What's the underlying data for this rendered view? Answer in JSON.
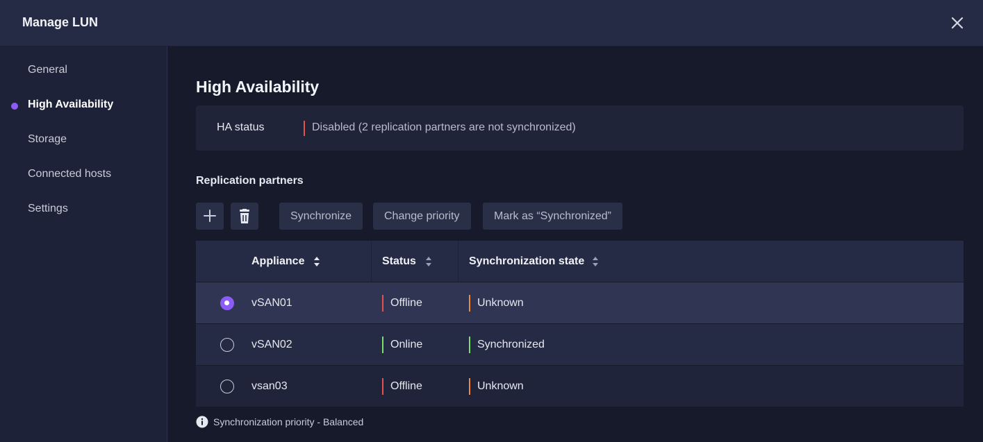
{
  "window": {
    "title": "Manage LUN"
  },
  "sidebar": {
    "items": [
      {
        "label": "General",
        "active": false
      },
      {
        "label": "High Availability",
        "active": true
      },
      {
        "label": "Storage",
        "active": false
      },
      {
        "label": "Connected hosts",
        "active": false
      },
      {
        "label": "Settings",
        "active": false
      }
    ]
  },
  "main": {
    "section_title": "High Availability",
    "ha_status": {
      "label": "HA status",
      "value": "Disabled (2 replication partners are not synchronized)",
      "status_color": "#e5534b"
    },
    "replication": {
      "title": "Replication partners",
      "toolbar": {
        "add_icon": "plus-icon",
        "delete_icon": "trash-icon",
        "synchronize_label": "Synchronize",
        "change_priority_label": "Change priority",
        "mark_synchronized_label": "Mark as “Synchronized”"
      },
      "columns": [
        "Appliance",
        "Status",
        "Synchronization state"
      ],
      "rows": [
        {
          "selected": true,
          "appliance": "vSAN01",
          "status": "Offline",
          "status_color": "#e5534b",
          "sync_state": "Unknown",
          "sync_color": "#f0883e"
        },
        {
          "selected": false,
          "appliance": "vSAN02",
          "status": "Online",
          "status_color": "#7ee06a",
          "sync_state": "Synchronized",
          "sync_color": "#7ee06a"
        },
        {
          "selected": false,
          "appliance": "vsan03",
          "status": "Offline",
          "status_color": "#e5534b",
          "sync_state": "Unknown",
          "sync_color": "#f0883e"
        }
      ]
    },
    "footer": {
      "icon": "info-icon",
      "text": "Synchronization priority - Balanced"
    }
  },
  "colors": {
    "accent": "#8b5cf6",
    "error": "#e5534b",
    "warning": "#f0883e",
    "success": "#7ee06a"
  }
}
